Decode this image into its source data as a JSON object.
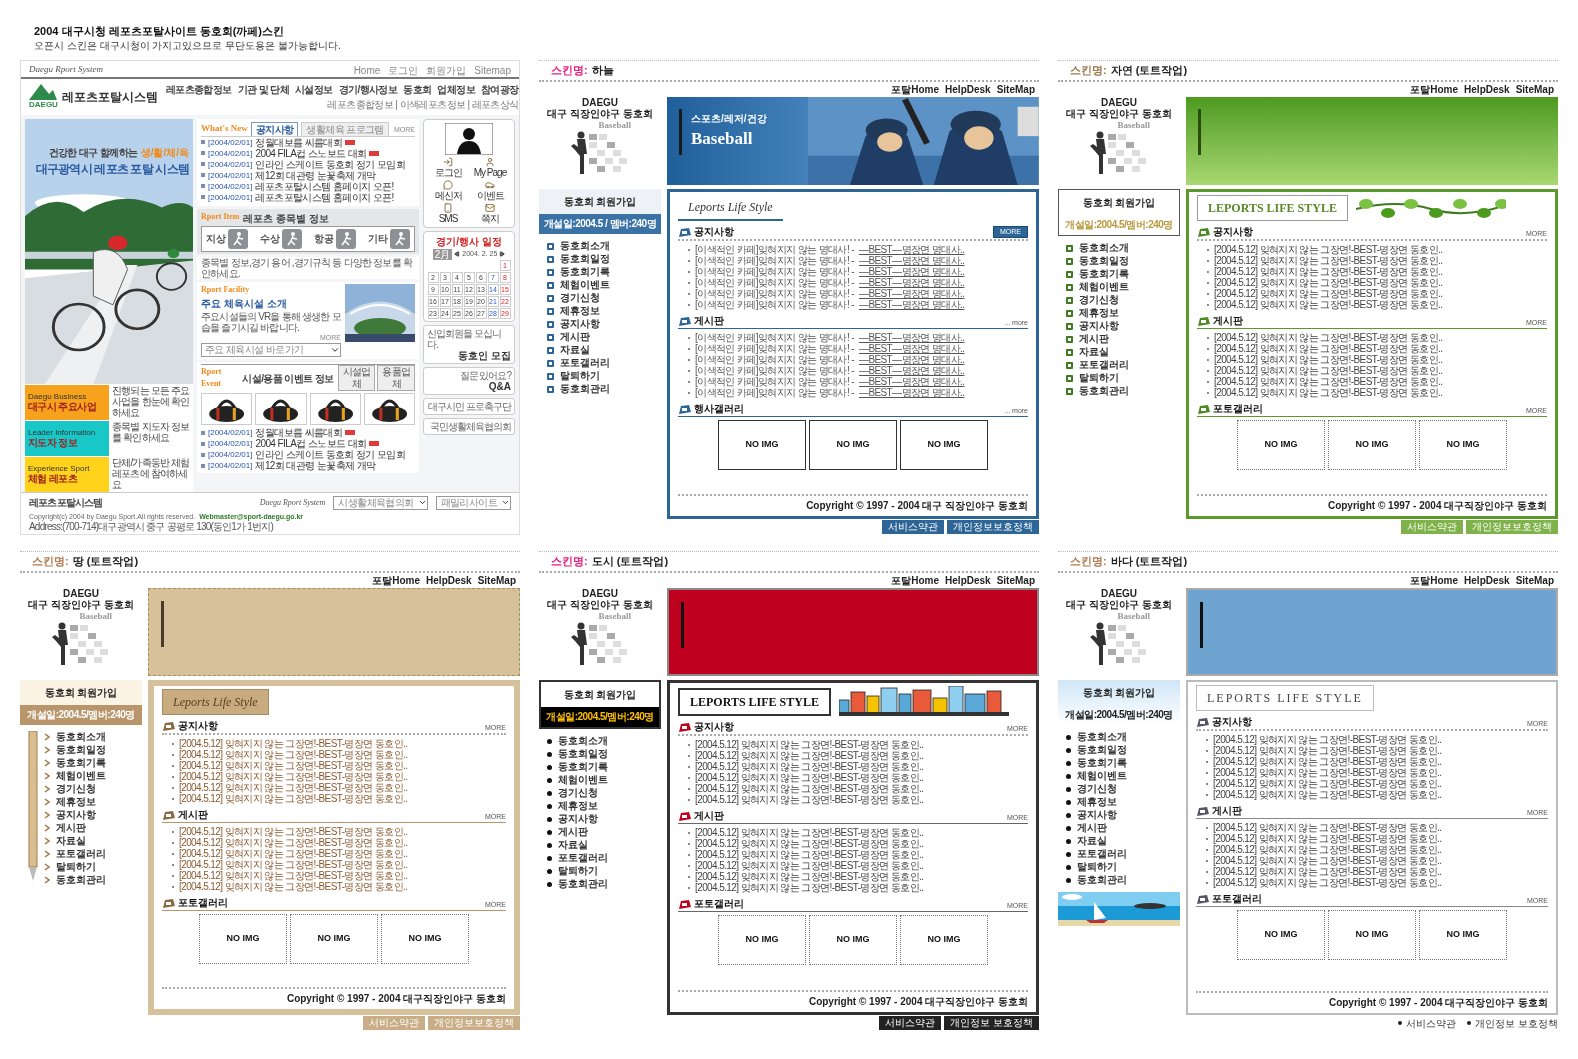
{
  "header": {
    "title": "2004 대구시청 레포츠포탈사이트 동호회(까페)스킨",
    "subtitle": "오픈시 스킨은 대구시청이 가지고있으므로 무단도용은 불가능합니다."
  },
  "portal": {
    "brand": "Daegu Rport System",
    "util_links": [
      "Home",
      "로그인",
      "회원가입",
      "Sitemap"
    ],
    "logo": {
      "mark": "DAEGU",
      "name": "레포츠포탈시스템"
    },
    "nav": [
      "레포츠종합정보",
      "기관 및 단체",
      "시설정보",
      "경기/행사정보",
      "동호회",
      "업체정보",
      "참여광장"
    ],
    "subnav": "레포츠종합정보 | 이색레포츠정보 | 레포츠상식",
    "hero": {
      "slogan": "건강한 대구 함께하는",
      "slogan_accent": "생/활/체/육",
      "title": "대구광역시 레포츠 포탈 시스템"
    },
    "promos": [
      {
        "en": "Daegu Business",
        "title": "대구시 주요사업",
        "desc": "진행되는 모든 주요사업을 한눈에 확인하세요"
      },
      {
        "en": "Leader Information",
        "title": "지도자 정보",
        "desc": "종목별 지도자 정보를 확인하세요"
      },
      {
        "en": "Experience Sport",
        "title": "체험 레포츠",
        "desc": "단체/가족동반 체험 레포츠에 참여하세요"
      }
    ],
    "news": {
      "label": "What's New",
      "tabs": [
        {
          "label": "공지사항",
          "selected": true
        },
        {
          "label": "생활체육 프로그램",
          "selected": false
        }
      ],
      "more": "MORE",
      "items": [
        {
          "date": "[2004/02/01]",
          "title": "정월대보름 씨름대회",
          "new": true
        },
        {
          "date": "[2004/02/01]",
          "title": "2004 FILA컵 스노보드 대회",
          "new": true
        },
        {
          "date": "[2004/02/01]",
          "title": "인라인 스케이트 동호회 정기 모임회",
          "new": false
        },
        {
          "date": "[2004/02/01]",
          "title": "제12회 대관령 눈꽃축제 개막",
          "new": false
        },
        {
          "date": "[2004/02/01]",
          "title": "레포츠포탈시스템 홈페이지 오픈!",
          "new": false
        },
        {
          "date": "[2004/02/01]",
          "title": "레포츠포탈시스템 홈페이지 오픈!",
          "new": false
        }
      ]
    },
    "sport": {
      "en": "Rport Item",
      "title": "레포츠 종목별 정보",
      "items": [
        "지상",
        "수상",
        "항공",
        "기타"
      ],
      "note": "종목별 정보,경기 용어 ,경기규칙 등 다양한 정보를 확인하세요."
    },
    "facility": {
      "en": "Rport Facility",
      "title": "주요 체육시설 소개",
      "desc": "주요시설들의 VR을 통해 생생한 모습을 즐기시길 바랍니다.",
      "more": "MORE",
      "select": "주요 체육시설 바로가기"
    },
    "event": {
      "en": "Rport Event",
      "title": "시설/용품 이벤트 정보",
      "tabs": [
        "시설업체",
        "용품업체"
      ],
      "items": [
        {
          "date": "[2004/02/01]",
          "title": "정월대보름 씨름대회",
          "new": true
        },
        {
          "date": "[2004/02/01]",
          "title": "2004 FILA컵 스노보드 대회",
          "new": true
        },
        {
          "date": "[2004/02/01]",
          "title": "인라인 스케이트 동호회 정기 모임회",
          "new": false
        },
        {
          "date": "[2004/02/01]",
          "title": "제12회 대관령 눈꽃축제 개막",
          "new": false
        }
      ]
    },
    "quick": [
      "로그인",
      "My Page",
      "메신저",
      "이벤트",
      "SMS",
      "쪽지"
    ],
    "calendar": {
      "title": "경기/행사 일정",
      "month": "2月",
      "date": "2004. 2. 25",
      "days": [
        "1",
        "2",
        "3",
        "4",
        "5",
        "6",
        "7",
        "8",
        "9",
        "10",
        "11",
        "12",
        "13",
        "14",
        "15",
        "16",
        "17",
        "18",
        "19",
        "20",
        "21",
        "22",
        "23",
        "24",
        "25",
        "26",
        "27",
        "28",
        "29"
      ]
    },
    "banners": [
      {
        "small": "신입회원을 모십니다.",
        "big": "동호인 모집"
      },
      {
        "small": "질문 있어요?",
        "big": "Q&A"
      },
      {
        "small": "대구시민 프로축구단"
      },
      {
        "small": "국민생활체육협의회"
      }
    ],
    "footer": {
      "brand": "레포츠포탈시스템",
      "system": "Daegu Rport System",
      "selects": [
        "시생활체육협의회",
        "패밀리사이트"
      ],
      "copyright": "Copyright(c) 2004 by Daegu Sport.All rights reserved.",
      "email": "Webmaster@sport-daegu.go.kr",
      "address": "Address:(700-714)대구광역시 중구 공평로 130(동인1가 1번지)"
    }
  },
  "skins": [
    {
      "kind": "sky",
      "label": "스킨명:",
      "name": "하늘",
      "links": [
        "포탈Home",
        "HelpDesk",
        "SiteMap"
      ],
      "club": {
        "name": "DAEGU",
        "subtitle": "대구 직장인야구 동호회",
        "logo": "Baseball"
      },
      "banner": {
        "kicker": "스포츠/레저/건강",
        "title": "Baseball"
      },
      "join": "동호회 회원가입",
      "info": "개설일:2004.5 / 멤버:240명",
      "menu": [
        "동호회소개",
        "동호회일정",
        "동호회기록",
        "체험이벤트",
        "경기신청",
        "제휴정보",
        "공지사항",
        "게시판",
        "자료실",
        "포토갤러리",
        "탈퇴하기",
        "동호회관리"
      ],
      "tagline": "Leports Life Style",
      "sections": [
        {
          "kind": "notice",
          "title": "공지사항",
          "more": "MORE",
          "rows": [
            {
              "text": "[이색적인 카페]잊혀지지 않는 명대사! -",
              "link": "—BEST—명장면 명대사.."
            },
            {
              "text": "[이색적인 카페]잊혀지지 않는 명대사! -",
              "link": "—BEST—명장면 명대사.."
            },
            {
              "text": "[이색적인 카페]잊혀지지 않는 명대사! -",
              "link": "—BEST—명장면 명대사.."
            },
            {
              "text": "[이색적인 카페]잊혀지지 않는 명대사! -",
              "link": "—BEST—명장면 명대사.."
            },
            {
              "text": "[이색적인 카페]잊혀지지 않는 명대사! -",
              "link": "—BEST—명장면 명대사.."
            },
            {
              "text": "[이색적인 카페]잊혀지지 않는 명대사! -",
              "link": "—BEST—명장면 명대사.."
            }
          ]
        },
        {
          "kind": "board",
          "title": "게시판",
          "more": "... more",
          "rows": [
            {
              "text": "[이색적인 카페]잊혀지지 않는 명대사! -",
              "link": "—BEST—명장면 명대사.."
            },
            {
              "text": "[이색적인 카페]잊혀지지 않는 명대사! -",
              "link": "—BEST—명장면 명대사.."
            },
            {
              "text": "[이색적인 카페]잊혀지지 않는 명대사! -",
              "link": "—BEST—명장면 명대사.."
            },
            {
              "text": "[이색적인 카페]잊혀지지 않는 명대사! -",
              "link": "—BEST—명장면 명대사.."
            },
            {
              "text": "[이색적인 카페]잊혀지지 않는 명대사! -",
              "link": "—BEST—명장면 명대사.."
            },
            {
              "text": "[이색적인 카페]잊혀지지 않는 명대사! -",
              "link": "—BEST—명장면 명대사.."
            }
          ]
        },
        {
          "kind": "gallery",
          "title": "행사갤러리",
          "more": "... more",
          "tiles": [
            "NO IMG",
            "NO IMG",
            "NO IMG"
          ]
        }
      ],
      "copyright": "Copyright © 1997 - 2004 대구 직장인야구 동호회",
      "footer_links": [
        "서비스약관",
        "개인정보보호정책"
      ]
    },
    {
      "kind": "nature",
      "label": "스킨명:",
      "name": "자연 (토트작업)",
      "links": [
        "포탈Home",
        "HelpDesk",
        "SiteMap"
      ],
      "club": {
        "name": "DAEGU",
        "subtitle": "대구 직장인야구 동호회",
        "logo": "Baseball"
      },
      "join": "동호회 회원가입",
      "info": "개설일:2004.5/멤버:240명",
      "menu": [
        "동호회소개",
        "동호회일정",
        "동호회기록",
        "체험이벤트",
        "경기신청",
        "제휴정보",
        "공지사항",
        "게시판",
        "자료실",
        "포토갤러리",
        "탈퇴하기",
        "동호회관리"
      ],
      "tagline": "LEPORTS LIFE STYLE",
      "sections": [
        {
          "kind": "notice",
          "title": "공지사항",
          "more": "MORE",
          "rows": [
            {
              "text": "[2004.5.12] 잊혀지지 않는 그장면!-BEST-명장면 동호인.."
            },
            {
              "text": "[2004.5.12] 잊혀지지 않는 그장면!-BEST-명장면 동호인.."
            },
            {
              "text": "[2004.5.12] 잊혀지지 않는 그장면!-BEST-명장면 동호인.."
            },
            {
              "text": "[2004.5.12] 잊혀지지 않는 그장면!-BEST-명장면 동호인.."
            },
            {
              "text": "[2004.5.12] 잊혀지지 않는 그장면!-BEST-명장면 동호인.."
            },
            {
              "text": "[2004.5.12] 잊혀지지 않는 그장면!-BEST-명장면 동호인.."
            }
          ]
        },
        {
          "kind": "board",
          "title": "게시판",
          "more": "MORE",
          "rows": [
            {
              "text": "[2004.5.12] 잊혀지지 않는 그장면!-BEST-명장면 동호인.."
            },
            {
              "text": "[2004.5.12] 잊혀지지 않는 그장면!-BEST-명장면 동호인.."
            },
            {
              "text": "[2004.5.12] 잊혀지지 않는 그장면!-BEST-명장면 동호인.."
            },
            {
              "text": "[2004.5.12] 잊혀지지 않는 그장면!-BEST-명장면 동호인.."
            },
            {
              "text": "[2004.5.12] 잊혀지지 않는 그장면!-BEST-명장면 동호인.."
            },
            {
              "text": "[2004.5.12] 잊혀지지 않는 그장면!-BEST-명장면 동호인.."
            }
          ]
        },
        {
          "kind": "gallery",
          "title": "포토갤러리",
          "more": "MORE",
          "tiles": [
            "NO IMG",
            "NO IMG",
            "NO IMG"
          ]
        }
      ],
      "copyright": "Copyright © 1997 - 2004 대구직장인야구 동호회",
      "footer_links": [
        "서비스약관",
        "개인정보보호정책"
      ]
    },
    {
      "kind": "earth",
      "label": "스킨명:",
      "name": "땅 (토트작업)",
      "links": [
        "포탈Home",
        "HelpDesk",
        "SiteMap"
      ],
      "club": {
        "name": "DAEGU",
        "subtitle": "대구 직장인야구 동호회",
        "logo": "Baseball"
      },
      "join": "동호회 회원가입",
      "info": "개설일:2004.5/멤버:240명",
      "menu": [
        "동호회소개",
        "동호회일정",
        "동호회기록",
        "체험이벤트",
        "경기신청",
        "제휴정보",
        "공지사항",
        "게시판",
        "자료실",
        "포토갤러리",
        "탈퇴하기",
        "동호회관리"
      ],
      "tagline": "Leports Life Style",
      "sections": [
        {
          "kind": "notice",
          "title": "공지사항",
          "more": "MORE",
          "rows": [
            {
              "text": "[2004.5.12] 잊혀지지 않는 그장면!-BEST-명장면 동호인.."
            },
            {
              "text": "[2004.5.12] 잊혀지지 않는 그장면!-BEST-명장면 동호인.."
            },
            {
              "text": "[2004.5.12] 잊혀지지 않는 그장면!-BEST-명장면 동호인.."
            },
            {
              "text": "[2004.5.12] 잊혀지지 않는 그장면!-BEST-명장면 동호인.."
            },
            {
              "text": "[2004.5.12] 잊혀지지 않는 그장면!-BEST-명장면 동호인.."
            },
            {
              "text": "[2004.5.12] 잊혀지지 않는 그장면!-BEST-명장면 동호인.."
            }
          ]
        },
        {
          "kind": "board",
          "title": "게시판",
          "more": "MORE",
          "rows": [
            {
              "text": "[2004.5.12] 잊혀지지 않는 그장면!-BEST-명장면 동호인.."
            },
            {
              "text": "[2004.5.12] 잊혀지지 않는 그장면!-BEST-명장면 동호인.."
            },
            {
              "text": "[2004.5.12] 잊혀지지 않는 그장면!-BEST-명장면 동호인.."
            },
            {
              "text": "[2004.5.12] 잊혀지지 않는 그장면!-BEST-명장면 동호인.."
            },
            {
              "text": "[2004.5.12] 잊혀지지 않는 그장면!-BEST-명장면 동호인.."
            },
            {
              "text": "[2004.5.12] 잊혀지지 않는 그장면!-BEST-명장면 동호인.."
            }
          ]
        },
        {
          "kind": "gallery",
          "title": "포토갤러리",
          "more": "MORE",
          "tiles": [
            "NO IMG",
            "NO IMG",
            "NO IMG"
          ]
        }
      ],
      "copyright": "Copyright © 1997 - 2004 대구직장인야구 동호회",
      "footer_links": [
        "서비스약관",
        "개인정보보호정책"
      ]
    },
    {
      "kind": "city",
      "label": "스킨명:",
      "name": "도시 (토트작업)",
      "links": [
        "포탈Home",
        "HelpDesk",
        "SiteMap"
      ],
      "club": {
        "name": "DAEGU",
        "subtitle": "대구 직장인야구 동호회",
        "logo": "Baseball"
      },
      "join": "동호회 회원가입",
      "info": "개설일:2004.5/멤버:240명",
      "menu": [
        "동호회소개",
        "동호회일정",
        "동호회기록",
        "체험이벤트",
        "경기신청",
        "제휴정보",
        "공지사항",
        "게시판",
        "자료실",
        "포토갤러리",
        "탈퇴하기",
        "동호회관리"
      ],
      "tagline": "LEPORTS LIFE STYLE",
      "sections": [
        {
          "kind": "notice",
          "title": "공지사항",
          "more": "MORE",
          "rows": [
            {
              "text": "[2004.5.12] 잊혀지지 않는 그장면!-BEST-명장면 동호인.."
            },
            {
              "text": "[2004.5.12] 잊혀지지 않는 그장면!-BEST-명장면 동호인.."
            },
            {
              "text": "[2004.5.12] 잊혀지지 않는 그장면!-BEST-명장면 동호인.."
            },
            {
              "text": "[2004.5.12] 잊혀지지 않는 그장면!-BEST-명장면 동호인.."
            },
            {
              "text": "[2004.5.12] 잊혀지지 않는 그장면!-BEST-명장면 동호인.."
            },
            {
              "text": "[2004.5.12] 잊혀지지 않는 그장면!-BEST-명장면 동호인.."
            }
          ]
        },
        {
          "kind": "board",
          "title": "게시판",
          "more": "MORE",
          "rows": [
            {
              "text": "[2004.5.12] 잊혀지지 않는 그장면!-BEST-명장면 동호인.."
            },
            {
              "text": "[2004.5.12] 잊혀지지 않는 그장면!-BEST-명장면 동호인.."
            },
            {
              "text": "[2004.5.12] 잊혀지지 않는 그장면!-BEST-명장면 동호인.."
            },
            {
              "text": "[2004.5.12] 잊혀지지 않는 그장면!-BEST-명장면 동호인.."
            },
            {
              "text": "[2004.5.12] 잊혀지지 않는 그장면!-BEST-명장면 동호인.."
            },
            {
              "text": "[2004.5.12] 잊혀지지 않는 그장면!-BEST-명장면 동호인.."
            }
          ]
        },
        {
          "kind": "gallery",
          "title": "포토갤러리",
          "more": "MORE",
          "tiles": [
            "NO IMG",
            "NO IMG",
            "NO IMG"
          ]
        }
      ],
      "copyright": "Copyright © 1997 - 2004 대구직장인야구 동호회",
      "footer_links": [
        "서비스약관",
        "개인정보 보호정책"
      ]
    },
    {
      "kind": "sea",
      "label": "스킨명:",
      "name": "바다 (토트작업)",
      "links": [
        "포탈Home",
        "HelpDesk",
        "SiteMap"
      ],
      "club": {
        "name": "DAEGU",
        "subtitle": "대구 직장인야구 동호회",
        "logo": "Baseball"
      },
      "join": "동호회 회원가입",
      "info": "개설일:2004.5/멤버:240명",
      "menu": [
        "동호회소개",
        "동호회일정",
        "동호회기록",
        "체험이벤트",
        "경기신청",
        "제휴정보",
        "공지사항",
        "게시판",
        "자료실",
        "포토갤러리",
        "탈퇴하기",
        "동호회관리"
      ],
      "tagline": "LEPORTS LIFE STYLE",
      "sections": [
        {
          "kind": "notice",
          "title": "공지사항",
          "more": "MORE",
          "rows": [
            {
              "text": "[2004.5.12] 잊혀지지 않는 그장면!-BEST-명장면 동호인.."
            },
            {
              "text": "[2004.5.12] 잊혀지지 않는 그장면!-BEST-명장면 동호인.."
            },
            {
              "text": "[2004.5.12] 잊혀지지 않는 그장면!-BEST-명장면 동호인.."
            },
            {
              "text": "[2004.5.12] 잊혀지지 않는 그장면!-BEST-명장면 동호인.."
            },
            {
              "text": "[2004.5.12] 잊혀지지 않는 그장면!-BEST-명장면 동호인.."
            },
            {
              "text": "[2004.5.12] 잊혀지지 않는 그장면!-BEST-명장면 동호인.."
            }
          ]
        },
        {
          "kind": "board",
          "title": "게시판",
          "more": "MORE",
          "rows": [
            {
              "text": "[2004.5.12] 잊혀지지 않는 그장면!-BEST-명장면 동호인.."
            },
            {
              "text": "[2004.5.12] 잊혀지지 않는 그장면!-BEST-명장면 동호인.."
            },
            {
              "text": "[2004.5.12] 잊혀지지 않는 그장면!-BEST-명장면 동호인.."
            },
            {
              "text": "[2004.5.12] 잊혀지지 않는 그장면!-BEST-명장면 동호인.."
            },
            {
              "text": "[2004.5.12] 잊혀지지 않는 그장면!-BEST-명장면 동호인.."
            },
            {
              "text": "[2004.5.12] 잊혀지지 않는 그장면!-BEST-명장면 동호인.."
            }
          ]
        },
        {
          "kind": "gallery",
          "title": "포토갤러리",
          "more": "MORE",
          "tiles": [
            "NO IMG",
            "NO IMG",
            "NO IMG"
          ]
        }
      ],
      "copyright": "Copyright © 1997 - 2004 대구직장인야구 동호회",
      "footer_links": [
        "서비스약관",
        "개인정보 보호정책"
      ]
    }
  ]
}
